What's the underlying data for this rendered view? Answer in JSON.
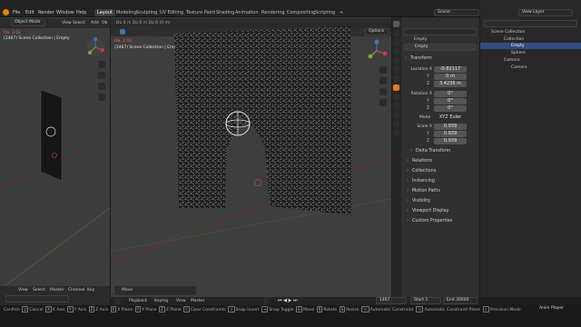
{
  "menus": [
    "File",
    "Edit",
    "Render",
    "Window",
    "Help"
  ],
  "workspace_tabs": [
    "Layout",
    "Modeling",
    "Sculpting",
    "UV Editing",
    "Texture Paint",
    "Shading",
    "Animation",
    "Rendering",
    "Compositing",
    "Scripting"
  ],
  "active_tab": "Layout",
  "scene_label": "Scene",
  "view_layer_label": "View Layer",
  "left_viewport": {
    "mode": "Object Mode",
    "menus": [
      "View",
      "Select",
      "Add",
      "Ob"
    ],
    "stats_line1": "Ов. 2.02",
    "stats_line2": "(1467) Scene Collection | Empty"
  },
  "main_viewport": {
    "header_text": "Do  0 m  Do  0 m  Do  0 (0 m)",
    "options_label": "Options",
    "stats_line1": "Ов. 2.02",
    "stats_line2": "(1467) Scene Collection | Empty",
    "move_label": "Move"
  },
  "properties": {
    "object_name": "Empty",
    "data_name": "Empty",
    "transform_label": "Transform",
    "location_label": "Location X",
    "location": [
      "-0.82117",
      "0 m",
      "3.4236 m"
    ],
    "rotation_label": "Rotation X",
    "rotation": [
      "0°",
      "0°",
      "0°"
    ],
    "mode_label": "Mode",
    "mode_value": "XYZ Euler",
    "scale_label": "Scale X",
    "scale": [
      "0.939",
      "0.939",
      "0.939"
    ],
    "axis_y": "Y",
    "axis_z": "Z",
    "delta_label": "Delta Transform",
    "sections": [
      "Relations",
      "Collections",
      "Instancing",
      "Motion Paths",
      "Visibility",
      "Viewport Display",
      "Custom Properties"
    ]
  },
  "outliner": {
    "root": "Scene Collection",
    "items": [
      {
        "label": "Collection",
        "level": 1
      },
      {
        "label": "Empty",
        "level": 2,
        "selected": true
      },
      {
        "label": "Sphere",
        "level": 2
      },
      {
        "label": "Camera",
        "level": 1
      },
      {
        "label": "Camera",
        "level": 2
      }
    ]
  },
  "timeline": {
    "menus": [
      "Playback",
      "Keying",
      "View",
      "Marker"
    ],
    "current_frame": "1467",
    "start_label": "Start",
    "start_value": "1",
    "end_label": "End",
    "end_value": "30000"
  },
  "left_bottom": {
    "menus": [
      "View",
      "Select",
      "Marker",
      "Channel",
      "Key"
    ]
  },
  "statusbar": {
    "items": [
      "Confirm",
      "Cancel",
      "X Axis",
      "Y Axis",
      "Z Axis",
      "X Plane",
      "Y Plane",
      "Z Plane",
      "Clear Constraints",
      "Snap Invert",
      "Snap Toggle",
      "Move",
      "Rotate",
      "Resize",
      "Automatic Constraint",
      "Automatic Constraint Plane",
      "Precision Mode",
      "Anim Player"
    ]
  },
  "colors": {
    "accent_blue": "#4772b3",
    "header": "#232323",
    "viewport": "#3e3e3e",
    "axis_red": "#c2413d",
    "axis_green": "#7ea634"
  }
}
